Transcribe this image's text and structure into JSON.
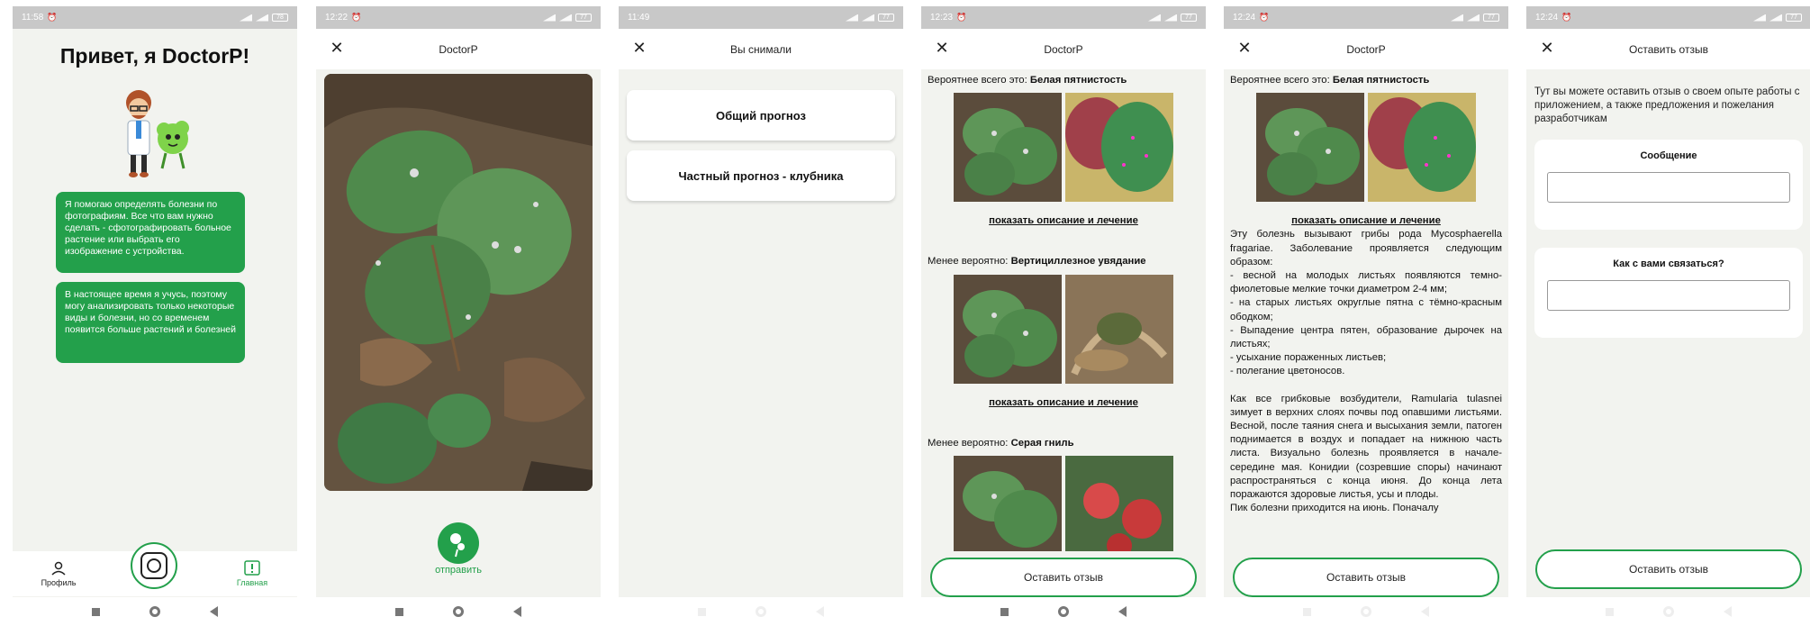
{
  "screens": {
    "s1": {
      "time": "11:58",
      "battery": "78",
      "title": "Привет, я DoctorP!",
      "bubble1": "Я помогаю определять болезни по фотографиям. Все что вам нужно сделать - сфотографировать больное растение или выбрать его изображение с устройства.",
      "bubble2": "В настоящее время я учусь, поэтому могу анализировать только некоторые виды и болезни, но со временем появится больше растений и болезней",
      "tab_profile": "Профиль",
      "tab_home": "Главная"
    },
    "s2": {
      "time": "12:22",
      "battery": "77",
      "title": "DoctorP",
      "send_label": "отправить"
    },
    "s3": {
      "time": "11:49",
      "battery": "77",
      "title": "Вы снимали",
      "btn_general": "Общий прогноз",
      "btn_private": "Частный прогноз - клубника"
    },
    "s4": {
      "time": "12:23",
      "battery": "77",
      "title": "DoctorP",
      "d1_prefix": "Вероятнее всего это: ",
      "d1_name": "Белая пятнистость",
      "link": "показать описание и лечение",
      "d2_prefix": "Менее вероятно: ",
      "d2_name": "Вертициллезное увядание",
      "d3_prefix": "Менее вероятно: ",
      "d3_name": "Серая гниль",
      "review": "Оставить отзыв"
    },
    "s5": {
      "time": "12:24",
      "battery": "77",
      "title": "DoctorP",
      "d1_prefix": "Вероятнее всего это: ",
      "d1_name": "Белая пятнистость",
      "link": "показать описание и лечение",
      "desc1": "Эту болезнь вызывают грибы рода Mycosphaerella fragariae. Заболевание проявляется следующим образом:",
      "desc2": "- весной на молодых листьях появляются темно-фиолетовые мелкие точки диаметром 2-4 мм;",
      "desc3": "- на старых листьях округлые пятна с тёмно-красным ободком;",
      "desc4": "- Выпадение центра пятен, образование дырочек на листьях;",
      "desc5": "- усыхание пораженных листьев;",
      "desc6": "- полегание цветоносов.",
      "desc7": "Как все грибковые возбудители, Ramularia tulasnei зимует в верхних слоях почвы под опавшими листьями. Весной, после таяния снега и высыхания земли, патоген поднимается в воздух и попадает на нижнюю часть листа. Визуально болезнь проявляется в начале-середине мая. Конидии (созревшие споры) начинают распространяться с конца июня. До конца лета поражаются здоровые листья, усы и плоды.",
      "desc8": "Пик болезни приходится на июнь. Поначалу",
      "review": "Оставить отзыв"
    },
    "s6": {
      "time": "12:24",
      "battery": "77",
      "title": "Оставить отзыв",
      "intro": "Тут вы можете оставить отзыв о своем опыте работы с приложением, а также предложения и пожелания разработчикам",
      "message_label": "Сообщение",
      "contact_label": "Как с вами связаться?",
      "review": "Оставить отзыв"
    }
  },
  "colors": {
    "accent": "#23a04b",
    "statusbar": "#c8c8c8",
    "background": "#f2f3ef"
  },
  "icons": [
    "close-icon",
    "profile-icon",
    "camera-icon",
    "home-alert-icon",
    "send-icon",
    "nav-square-icon",
    "nav-circle-icon",
    "nav-back-icon"
  ]
}
